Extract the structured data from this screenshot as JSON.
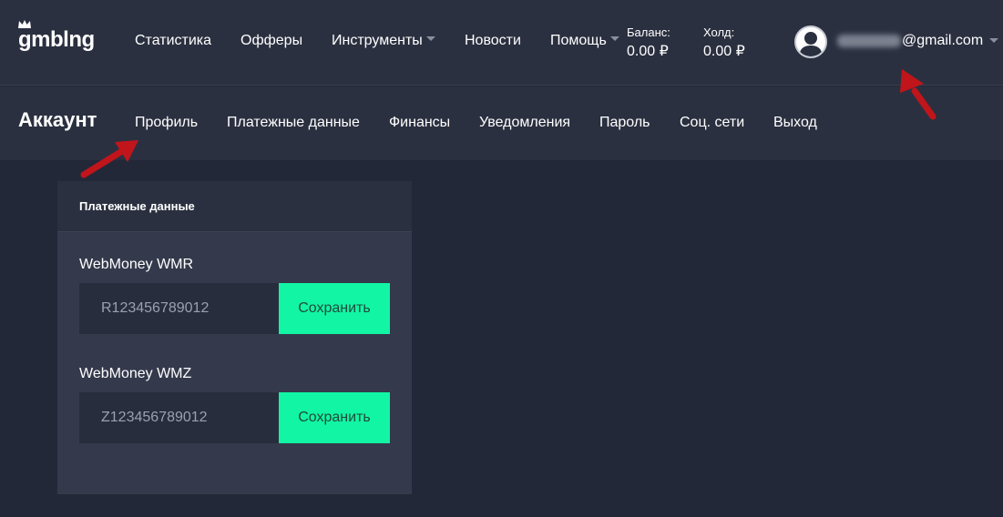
{
  "header": {
    "logo": "gmblng",
    "nav": [
      {
        "label": "Статистика",
        "dropdown": false
      },
      {
        "label": "Офферы",
        "dropdown": false
      },
      {
        "label": "Инструменты",
        "dropdown": true
      },
      {
        "label": "Новости",
        "dropdown": false
      },
      {
        "label": "Помощь",
        "dropdown": true
      }
    ],
    "balance": {
      "label": "Баланс:",
      "value": "0.00 ₽"
    },
    "hold": {
      "label": "Холд:",
      "value": "0.00 ₽"
    },
    "user": {
      "email_domain": "@gmail.com",
      "avatar_icon": "user-avatar-icon"
    }
  },
  "account_bar": {
    "title": "Аккаунт",
    "tabs": [
      {
        "label": "Профиль"
      },
      {
        "label": "Платежные данные"
      },
      {
        "label": "Финансы"
      },
      {
        "label": "Уведомления"
      },
      {
        "label": "Пароль"
      },
      {
        "label": "Соц. сети"
      },
      {
        "label": "Выход"
      }
    ]
  },
  "card": {
    "title": "Платежные данные",
    "fields": [
      {
        "label": "WebMoney WMR",
        "placeholder": "R123456789012",
        "button": "Сохранить"
      },
      {
        "label": "WebMoney WMZ",
        "placeholder": "Z123456789012",
        "button": "Сохранить"
      }
    ]
  },
  "colors": {
    "background": "#232838",
    "bar": "#2b3040",
    "card": "#343a4c",
    "input": "#282d3d",
    "accent": "#12f5a4",
    "annotation_arrow": "#c0151b"
  }
}
